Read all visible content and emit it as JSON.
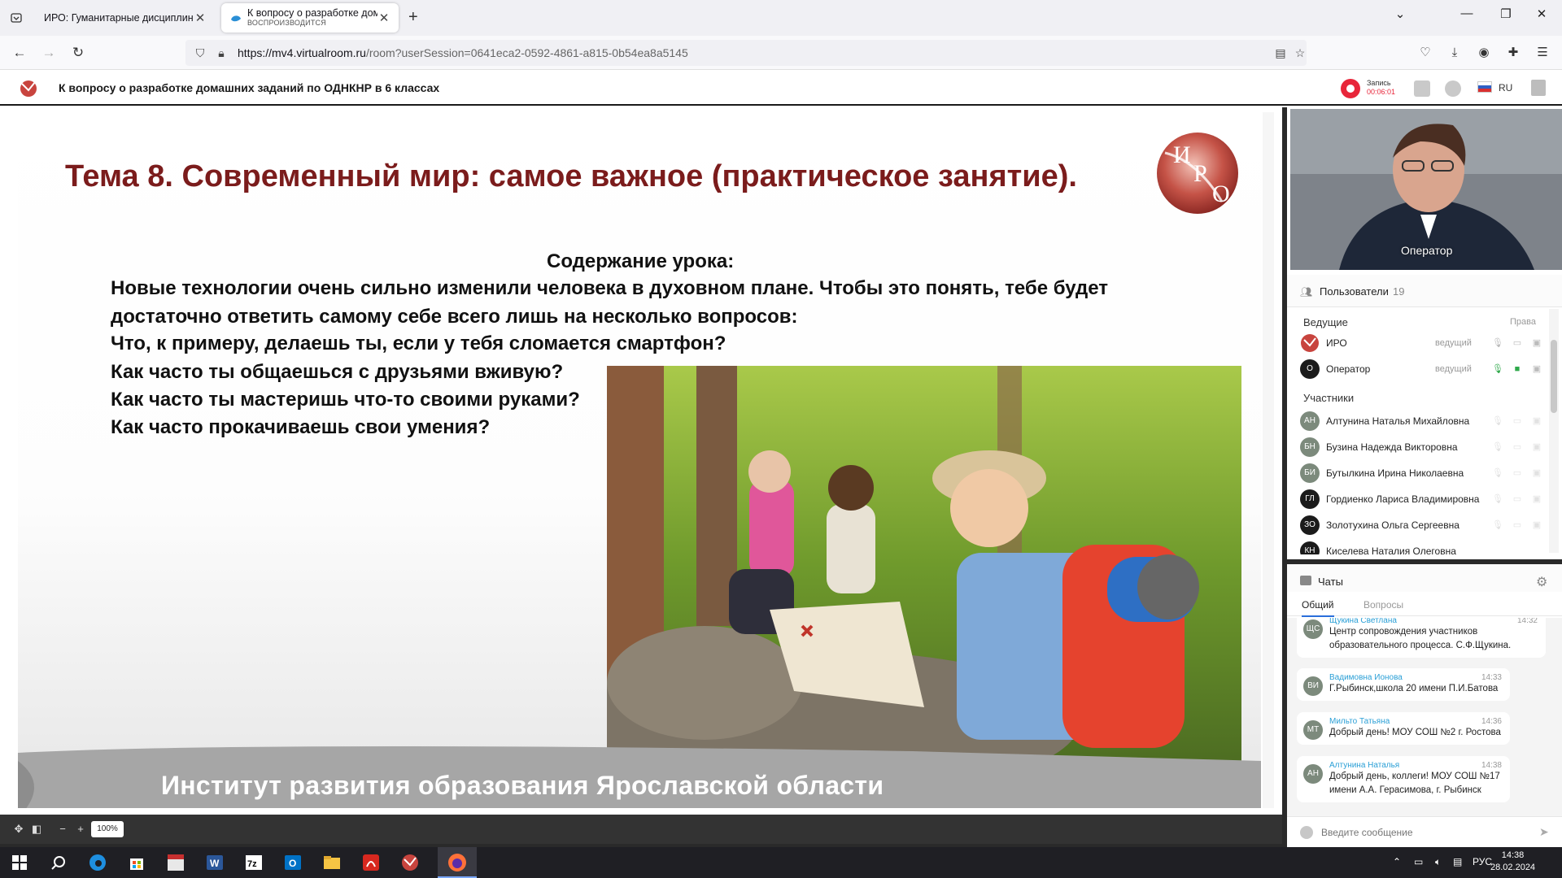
{
  "browser": {
    "tabs": [
      {
        "title": "ИРО: Гуманитарные дисциплины"
      },
      {
        "title": "К вопросу о разработке домашних",
        "subtitle": "ВОСПРОИЗВОДИТСЯ"
      }
    ],
    "url_host": "https://mv4.virtualroom.ru",
    "url_path": "/room?userSession=0641eca2-0592-4861-a815-0b54ea8a5145"
  },
  "app": {
    "title": "К вопросу о разработке домашних заданий по ОДНКНР в 6 классах",
    "record_label": "Запись",
    "record_time": "00:06:01",
    "language": "RU"
  },
  "slide": {
    "title": "Тема 8. Современный мир: самое важное (практическое занятие).",
    "logo_letters": [
      "И",
      "Р",
      "О"
    ],
    "content_heading": "Содержание урока:",
    "lines": [
      "Новые технологии очень сильно изменили человека в духовном плане. Чтобы это понять, тебе будет",
      "достаточно ответить самому себе всего лишь на несколько вопросов:",
      "Что, к примеру, делаешь ты, если у тебя сломается смартфон?",
      "Как часто ты общаешься с друзьями вживую?",
      "Как часто ты мастеришь что-то своими руками?",
      "Как часто прокачиваешь свои умения?"
    ],
    "footer": "Институт развития образования Ярославской области"
  },
  "zoom": {
    "percent": "100%"
  },
  "video": {
    "label": "Оператор"
  },
  "users": {
    "title": "Пользователи",
    "count": "19",
    "hosts_title": "Ведущие",
    "rights_label": "Права",
    "hosts": [
      {
        "name": "ИРО",
        "role": "ведущий"
      },
      {
        "name": "Оператор",
        "initials": "О",
        "role": "ведущий"
      }
    ],
    "participants_title": "Участники",
    "participants": [
      {
        "initials": "АН",
        "name": "Алтунина Наталья Михайловна"
      },
      {
        "initials": "БН",
        "name": "Бузина Надежда Викторовна"
      },
      {
        "initials": "БИ",
        "name": "Бутылкина Ирина Николаевна"
      },
      {
        "initials": "ГЛ",
        "name": "Гордиенко Лариса Владимировна"
      },
      {
        "initials": "ЗО",
        "name": "Золотухина Ольга Сергеевна"
      },
      {
        "initials": "КН",
        "name": "Киселева Наталия Олеговна"
      }
    ]
  },
  "chats": {
    "title": "Чаты",
    "tab_general": "Общий",
    "tab_questions": "Вопросы",
    "messages": [
      {
        "initials": "ЩС",
        "name": "Щукина Светлана",
        "time": "14:32",
        "text": [
          "Центр сопровождения участников",
          "образовательного процесса. С.Ф.Щукина."
        ]
      },
      {
        "initials": "ВИ",
        "name": "Вадимовна Ионова",
        "time": "14:33",
        "text": [
          "Г.Рыбинск,школа 20 имени П.И.Батова"
        ]
      },
      {
        "initials": "МТ",
        "name": "Мильто Татьяна",
        "time": "14:36",
        "text": [
          "Добрый день! МОУ СОШ №2 г. Ростова"
        ]
      },
      {
        "initials": "АН",
        "name": "Алтунина Наталья",
        "time": "14:38",
        "text": [
          "Добрый день, коллеги! МОУ СОШ №17",
          "имени А.А. Герасимова, г. Рыбинск"
        ]
      }
    ],
    "input_placeholder": "Введите сообщение"
  },
  "taskbar": {
    "language": "РУС",
    "time": "14:38",
    "date": "28.02.2024"
  },
  "colors": {
    "title_red": "#7b1c1c",
    "record_red": "#e8263a",
    "chat_name": "#2a9fd6",
    "mic_on": "#2ea84a"
  },
  "icons": [
    "tab-list-icon",
    "close-icon",
    "new-tab-icon",
    "minimize-icon",
    "restore-icon",
    "back-icon",
    "forward-icon",
    "reload-icon",
    "shield-icon",
    "lock-icon",
    "reader-icon",
    "star-icon",
    "pocket-icon",
    "download-icon",
    "account-icon",
    "extensions-icon",
    "menu-icon",
    "record-icon",
    "folder-icon",
    "info-icon",
    "flag-icon",
    "exit-icon",
    "users-icon",
    "mic-icon",
    "camera-icon",
    "screen-icon",
    "chat-icon",
    "gear-icon",
    "emoji-icon",
    "send-icon",
    "windows-start-icon",
    "search-icon"
  ]
}
